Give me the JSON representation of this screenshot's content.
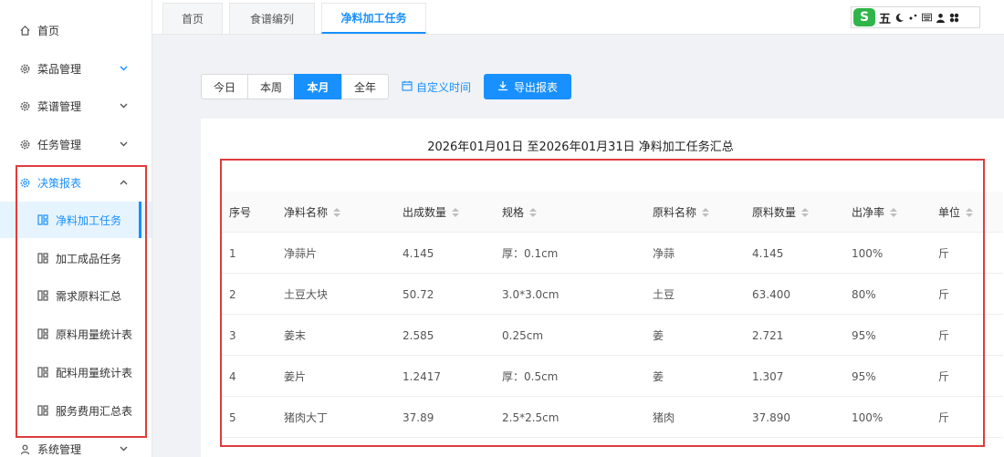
{
  "sidebar": {
    "items": [
      {
        "label": "首页",
        "icon": "home-icon"
      },
      {
        "label": "菜品管理",
        "icon": "gear-icon"
      },
      {
        "label": "菜谱管理",
        "icon": "gear-icon"
      },
      {
        "label": "任务管理",
        "icon": "gear-icon"
      },
      {
        "label": "决策报表",
        "icon": "gear-icon"
      }
    ],
    "sub_items": [
      {
        "label": "净料加工任务"
      },
      {
        "label": "加工成品任务"
      },
      {
        "label": "需求原料汇总"
      },
      {
        "label": "原料用量统计表"
      },
      {
        "label": "配料用量统计表"
      },
      {
        "label": "服务费用汇总表"
      }
    ],
    "bottom_item": {
      "label": "系统管理"
    },
    "accent": "#1890ff"
  },
  "tabs": [
    {
      "label": "首页"
    },
    {
      "label": "食谱编列"
    },
    {
      "label": "净料加工任务"
    }
  ],
  "ime": {
    "logo": "S",
    "mode": "五"
  },
  "filters": {
    "options": [
      "今日",
      "本周",
      "本月",
      "全年"
    ],
    "selected": "本月",
    "custom_time": "自定义时间",
    "export": "导出报表"
  },
  "report": {
    "title": "2026年01月01日 至2026年01月31日 净料加工任务汇总",
    "columns": [
      "序号",
      "净料名称",
      "出成数量",
      "规格",
      "原料名称",
      "原料数量",
      "出净率",
      "单位"
    ],
    "rows": [
      [
        "1",
        "净蒜片",
        "4.145",
        "厚：0.1cm",
        "净蒜",
        "4.145",
        "100%",
        "斤"
      ],
      [
        "2",
        "土豆大块",
        "50.72",
        "3.0*3.0cm",
        "土豆",
        "63.400",
        "80%",
        "斤"
      ],
      [
        "3",
        "姜末",
        "2.585",
        "0.25cm",
        "姜",
        "2.721",
        "95%",
        "斤"
      ],
      [
        "4",
        "姜片",
        "1.2417",
        "厚：0.5cm",
        "姜",
        "1.307",
        "95%",
        "斤"
      ],
      [
        "5",
        "猪肉大丁",
        "37.89",
        "2.5*2.5cm",
        "猪肉",
        "37.890",
        "100%",
        "斤"
      ]
    ]
  },
  "highlight_color": "#e03c3c"
}
